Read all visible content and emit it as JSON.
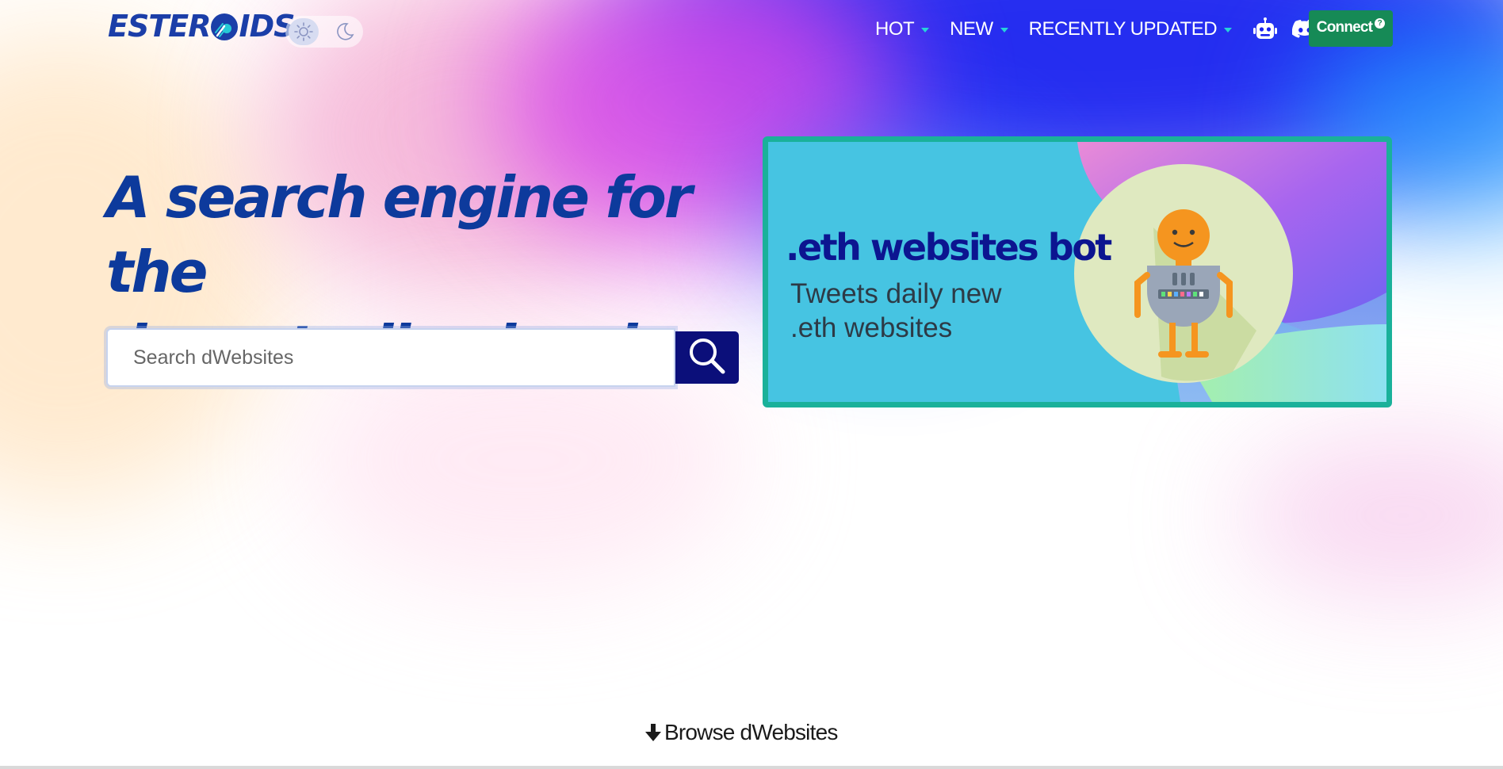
{
  "brand": {
    "logo_left": "ESTER",
    "logo_right": "IDS"
  },
  "theme_toggle": {
    "light_icon": "sun-icon",
    "dark_icon": "moon-icon",
    "active": "light"
  },
  "nav": {
    "items": [
      {
        "label": "HOT",
        "icon": "caret-down-icon"
      },
      {
        "label": "NEW",
        "icon": "caret-down-icon"
      },
      {
        "label": "RECENTLY UPDATED",
        "icon": "caret-down-icon"
      }
    ],
    "social_icons": [
      "robot-icon",
      "discord-icon",
      "twitter-icon"
    ],
    "connect_label": "Connect",
    "connect_badge": "?"
  },
  "hero": {
    "title_line1": "A search engine for the",
    "title_line2": "decentralized web",
    "search_placeholder": "Search dWebsites",
    "search_icon": "search-icon"
  },
  "banner": {
    "title": ".eth websites bot",
    "subtitle_line1": "Tweets daily new",
    "subtitle_line2": ".eth websites",
    "illustration": "robot-illustration"
  },
  "browse": {
    "label": "Browse dWebsites",
    "icon": "arrow-down-icon"
  },
  "colors": {
    "brand_blue": "#0d3a9c",
    "connect_green": "#168a56",
    "search_button": "#0b0f7a",
    "banner_border": "#1ab19a",
    "banner_bg": "#46c4e2",
    "nav_caret": "#26d3d8"
  }
}
